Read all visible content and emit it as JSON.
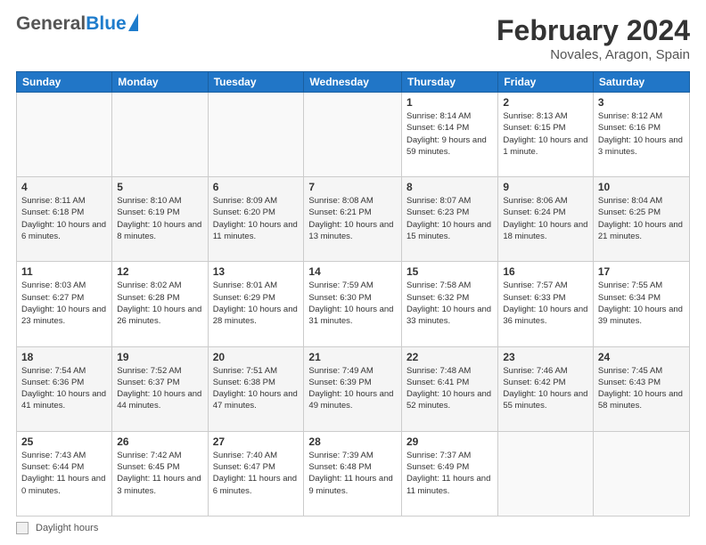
{
  "header": {
    "logo_general": "General",
    "logo_blue": "Blue",
    "month_year": "February 2024",
    "location": "Novales, Aragon, Spain"
  },
  "calendar": {
    "days_of_week": [
      "Sunday",
      "Monday",
      "Tuesday",
      "Wednesday",
      "Thursday",
      "Friday",
      "Saturday"
    ],
    "weeks": [
      [
        {
          "day": "",
          "info": ""
        },
        {
          "day": "",
          "info": ""
        },
        {
          "day": "",
          "info": ""
        },
        {
          "day": "",
          "info": ""
        },
        {
          "day": "1",
          "info": "Sunrise: 8:14 AM\nSunset: 6:14 PM\nDaylight: 9 hours\nand 59 minutes."
        },
        {
          "day": "2",
          "info": "Sunrise: 8:13 AM\nSunset: 6:15 PM\nDaylight: 10 hours\nand 1 minute."
        },
        {
          "day": "3",
          "info": "Sunrise: 8:12 AM\nSunset: 6:16 PM\nDaylight: 10 hours\nand 3 minutes."
        }
      ],
      [
        {
          "day": "4",
          "info": "Sunrise: 8:11 AM\nSunset: 6:18 PM\nDaylight: 10 hours\nand 6 minutes."
        },
        {
          "day": "5",
          "info": "Sunrise: 8:10 AM\nSunset: 6:19 PM\nDaylight: 10 hours\nand 8 minutes."
        },
        {
          "day": "6",
          "info": "Sunrise: 8:09 AM\nSunset: 6:20 PM\nDaylight: 10 hours\nand 11 minutes."
        },
        {
          "day": "7",
          "info": "Sunrise: 8:08 AM\nSunset: 6:21 PM\nDaylight: 10 hours\nand 13 minutes."
        },
        {
          "day": "8",
          "info": "Sunrise: 8:07 AM\nSunset: 6:23 PM\nDaylight: 10 hours\nand 15 minutes."
        },
        {
          "day": "9",
          "info": "Sunrise: 8:06 AM\nSunset: 6:24 PM\nDaylight: 10 hours\nand 18 minutes."
        },
        {
          "day": "10",
          "info": "Sunrise: 8:04 AM\nSunset: 6:25 PM\nDaylight: 10 hours\nand 21 minutes."
        }
      ],
      [
        {
          "day": "11",
          "info": "Sunrise: 8:03 AM\nSunset: 6:27 PM\nDaylight: 10 hours\nand 23 minutes."
        },
        {
          "day": "12",
          "info": "Sunrise: 8:02 AM\nSunset: 6:28 PM\nDaylight: 10 hours\nand 26 minutes."
        },
        {
          "day": "13",
          "info": "Sunrise: 8:01 AM\nSunset: 6:29 PM\nDaylight: 10 hours\nand 28 minutes."
        },
        {
          "day": "14",
          "info": "Sunrise: 7:59 AM\nSunset: 6:30 PM\nDaylight: 10 hours\nand 31 minutes."
        },
        {
          "day": "15",
          "info": "Sunrise: 7:58 AM\nSunset: 6:32 PM\nDaylight: 10 hours\nand 33 minutes."
        },
        {
          "day": "16",
          "info": "Sunrise: 7:57 AM\nSunset: 6:33 PM\nDaylight: 10 hours\nand 36 minutes."
        },
        {
          "day": "17",
          "info": "Sunrise: 7:55 AM\nSunset: 6:34 PM\nDaylight: 10 hours\nand 39 minutes."
        }
      ],
      [
        {
          "day": "18",
          "info": "Sunrise: 7:54 AM\nSunset: 6:36 PM\nDaylight: 10 hours\nand 41 minutes."
        },
        {
          "day": "19",
          "info": "Sunrise: 7:52 AM\nSunset: 6:37 PM\nDaylight: 10 hours\nand 44 minutes."
        },
        {
          "day": "20",
          "info": "Sunrise: 7:51 AM\nSunset: 6:38 PM\nDaylight: 10 hours\nand 47 minutes."
        },
        {
          "day": "21",
          "info": "Sunrise: 7:49 AM\nSunset: 6:39 PM\nDaylight: 10 hours\nand 49 minutes."
        },
        {
          "day": "22",
          "info": "Sunrise: 7:48 AM\nSunset: 6:41 PM\nDaylight: 10 hours\nand 52 minutes."
        },
        {
          "day": "23",
          "info": "Sunrise: 7:46 AM\nSunset: 6:42 PM\nDaylight: 10 hours\nand 55 minutes."
        },
        {
          "day": "24",
          "info": "Sunrise: 7:45 AM\nSunset: 6:43 PM\nDaylight: 10 hours\nand 58 minutes."
        }
      ],
      [
        {
          "day": "25",
          "info": "Sunrise: 7:43 AM\nSunset: 6:44 PM\nDaylight: 11 hours\nand 0 minutes."
        },
        {
          "day": "26",
          "info": "Sunrise: 7:42 AM\nSunset: 6:45 PM\nDaylight: 11 hours\nand 3 minutes."
        },
        {
          "day": "27",
          "info": "Sunrise: 7:40 AM\nSunset: 6:47 PM\nDaylight: 11 hours\nand 6 minutes."
        },
        {
          "day": "28",
          "info": "Sunrise: 7:39 AM\nSunset: 6:48 PM\nDaylight: 11 hours\nand 9 minutes."
        },
        {
          "day": "29",
          "info": "Sunrise: 7:37 AM\nSunset: 6:49 PM\nDaylight: 11 hours\nand 11 minutes."
        },
        {
          "day": "",
          "info": ""
        },
        {
          "day": "",
          "info": ""
        }
      ]
    ]
  },
  "footer": {
    "daylight_label": "Daylight hours"
  }
}
